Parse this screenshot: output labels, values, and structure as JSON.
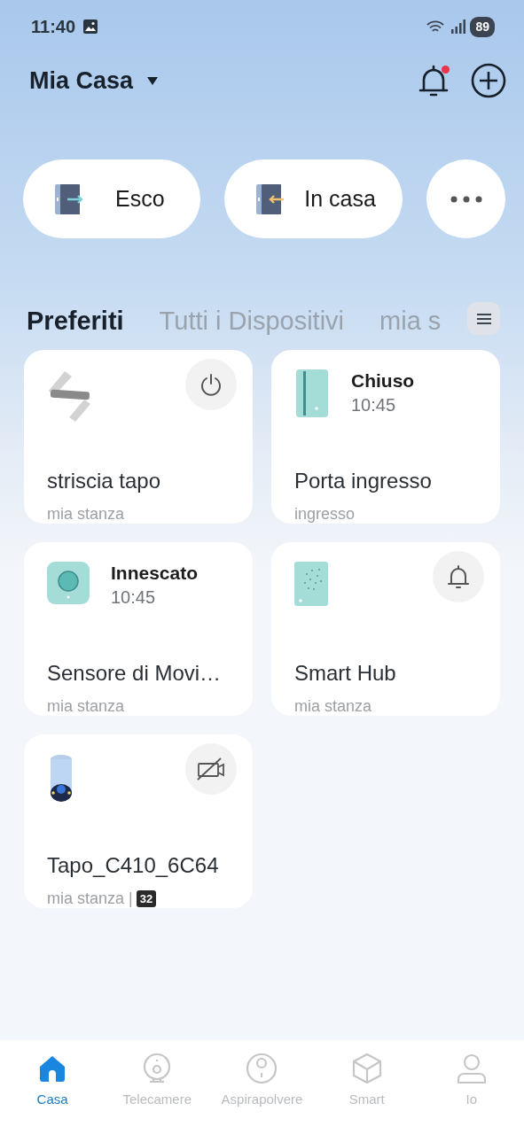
{
  "status_bar": {
    "time": "11:40",
    "battery": "89"
  },
  "header": {
    "home_name": "Mia Casa",
    "notification": true
  },
  "scenes": [
    {
      "kind": "leave",
      "label": "Esco"
    },
    {
      "kind": "home",
      "label": "In casa"
    },
    {
      "kind": "more"
    }
  ],
  "tabs": [
    {
      "label": "Preferiti",
      "selected": true
    },
    {
      "label": "Tutti i Dispositivi",
      "selected": false
    },
    {
      "label": "mia s",
      "selected": false
    }
  ],
  "devices": [
    {
      "kind": "strip",
      "name": "striscia tapo",
      "room": "mia stanza",
      "action": {
        "kind": "power"
      }
    },
    {
      "kind": "door",
      "name": "Porta ingresso",
      "room": "ingresso",
      "status": "Chiuso",
      "time": "10:45"
    },
    {
      "kind": "motion",
      "name": "Sensore di Movi…",
      "room": "mia stanza",
      "status": "Innescato",
      "time": "10:45"
    },
    {
      "kind": "hub",
      "name": "Smart Hub",
      "room": "mia stanza",
      "action": {
        "kind": "bell"
      }
    },
    {
      "kind": "camera",
      "name": "Tapo_C410_6C64",
      "room": "mia stanza |",
      "badge": "32",
      "action": {
        "kind": "camera-off"
      }
    }
  ],
  "bottom_nav": [
    {
      "kind": "home",
      "label": "Casa",
      "selected": true
    },
    {
      "kind": "camera",
      "label": "Telecamere",
      "selected": false
    },
    {
      "kind": "vacuum",
      "label": "Aspirapolvere",
      "selected": false
    },
    {
      "kind": "cube",
      "label": "Smart",
      "selected": false
    },
    {
      "kind": "person",
      "label": "Io",
      "selected": false
    }
  ]
}
